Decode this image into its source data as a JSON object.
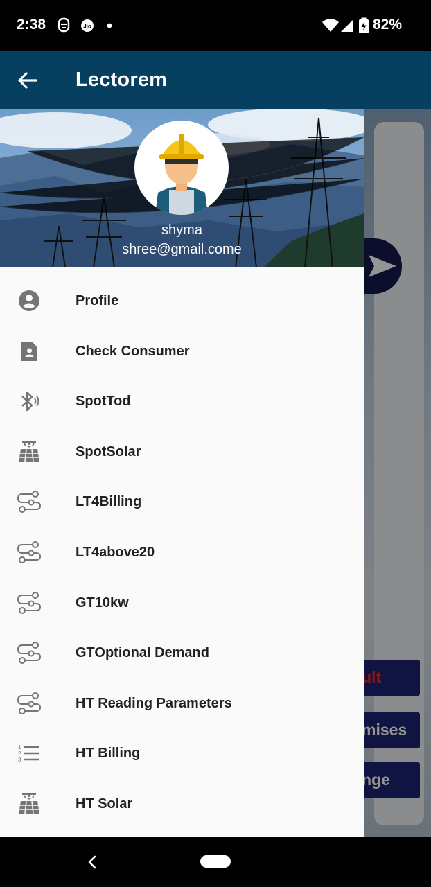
{
  "status_bar": {
    "time": "2:38",
    "battery_percent": "82%",
    "icons": [
      "face-id-icon",
      "jio-icon",
      "dot-icon",
      "wifi-icon",
      "signal-icon",
      "battery-charging-icon"
    ]
  },
  "app_bar": {
    "title": "Lectorem",
    "back_icon": "arrow-left-icon",
    "color": "#063f5f"
  },
  "drawer": {
    "user": {
      "name": "shyma",
      "email": "shree@gmail.come"
    },
    "items": [
      {
        "label": "Profile",
        "icon": "account-circle-icon"
      },
      {
        "label": "Check Consumer",
        "icon": "contact-document-icon"
      },
      {
        "label": "SpotTod",
        "icon": "bluetooth-audio-icon"
      },
      {
        "label": "SpotSolar",
        "icon": "solar-panel-icon"
      },
      {
        "label": "LT4Billing",
        "icon": "route-icon"
      },
      {
        "label": "LT4above20",
        "icon": "route-icon"
      },
      {
        "label": "GT10kw",
        "icon": "route-icon"
      },
      {
        "label": "GTOptional Demand",
        "icon": "route-icon"
      },
      {
        "label": "HT Reading Parameters",
        "icon": "route-icon"
      },
      {
        "label": "HT Billing",
        "icon": "numbered-list-icon"
      },
      {
        "label": "HT Solar",
        "icon": "solar-panel-icon"
      }
    ]
  },
  "background": {
    "buttons": [
      "ult",
      "mises",
      "nge"
    ]
  }
}
